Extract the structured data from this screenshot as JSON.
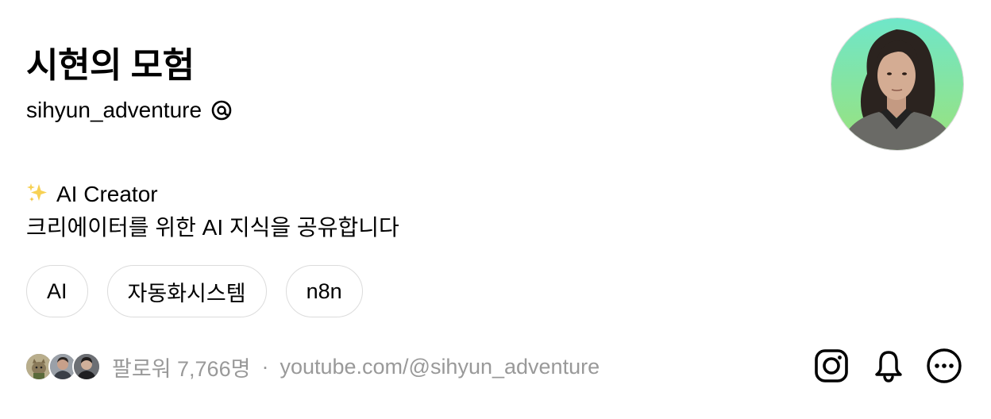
{
  "profile": {
    "display_name": "시현의 모험",
    "username": "sihyun_adventure",
    "bio_line1": "AI Creator",
    "bio_line2": "크리에이터를 위한 AI 지식을 공유합니다"
  },
  "tags": [
    "AI",
    "자동화시스템",
    "n8n"
  ],
  "footer": {
    "followers_text": "팔로워 7,766명",
    "separator": "·",
    "link_text": "youtube.com/@sihyun_adventure"
  },
  "icons": {
    "threads": "threads-icon",
    "sparkle": "sparkle-icon",
    "instagram": "instagram-icon",
    "notification": "bell-icon",
    "more": "more-icon"
  },
  "colors": {
    "text_primary": "#000000",
    "text_secondary": "#999999",
    "tag_border": "#dcdcdc",
    "avatar_bg_top": "#6fe6c9",
    "avatar_bg_bottom": "#9be27a"
  }
}
